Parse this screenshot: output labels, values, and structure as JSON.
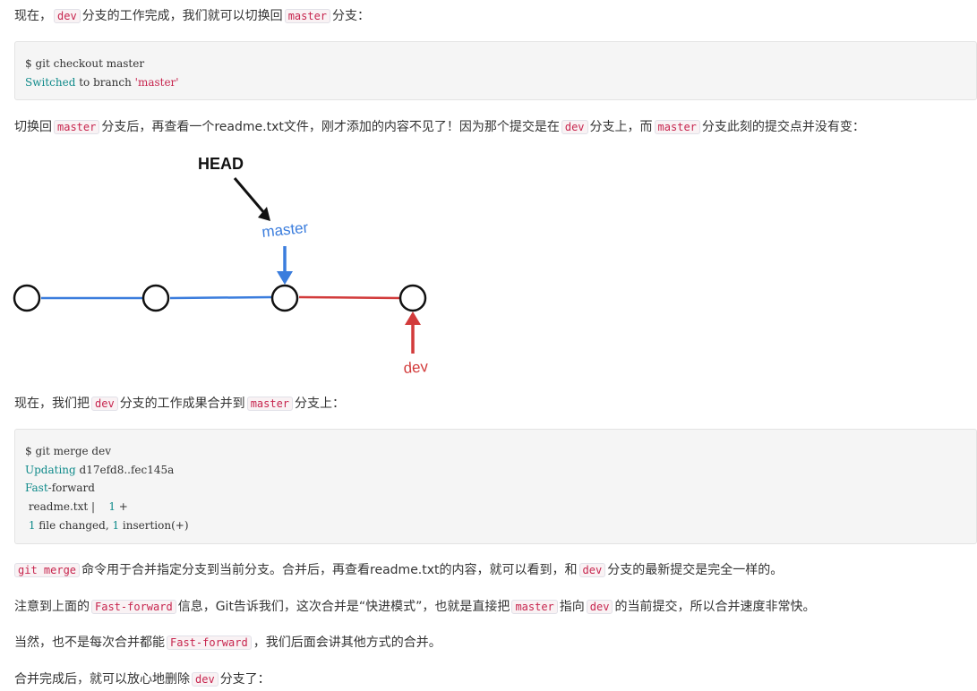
{
  "p1": {
    "a": "现在，",
    "code1": "dev",
    "b": "分支的工作完成，我们就可以切换回",
    "code2": "master",
    "c": "分支："
  },
  "code1": {
    "line1": "$ git checkout master",
    "line2_kw": "Switched",
    "line2_mid": " to branch ",
    "line2_str": "'master'"
  },
  "p2": {
    "a": "切换回",
    "code1": "master",
    "b": "分支后，再查看一个readme.txt文件，刚才添加的内容不见了！因为那个提交是在",
    "code2": "dev",
    "c": "分支上，而",
    "code3": "master",
    "d": "分支此刻的提交点并没有变："
  },
  "diagram": {
    "head_label": "HEAD",
    "master_label": "master",
    "dev_label": "dev",
    "colors": {
      "blue": "#3b7ddd",
      "red": "#d23b3b",
      "black": "#111111"
    }
  },
  "p3": {
    "a": "现在，我们把",
    "code1": "dev",
    "b": "分支的工作成果合并到",
    "code2": "master",
    "c": "分支上："
  },
  "code2": {
    "line1": "$ git merge dev",
    "line2_kw": "Updating",
    "line2_rest": " d17efd8..fec145a",
    "line3_kw": "Fast",
    "line3_rest": "-forward",
    "line4_a": " readme.txt |    ",
    "line4_num": "1",
    "line4_b": " +",
    "line5_num1": " 1",
    "line5_a": " file changed, ",
    "line5_num2": "1",
    "line5_b": " insertion(+)"
  },
  "p4": {
    "code1": "git merge",
    "a": "命令用于合并指定分支到当前分支。合并后，再查看readme.txt的内容，就可以看到，和",
    "code2": "dev",
    "b": "分支的最新提交是完全一样的。"
  },
  "p5": {
    "a": "注意到上面的",
    "code1": "Fast-forward",
    "b": "信息，Git告诉我们，这次合并是“快进模式”，也就是直接把",
    "code2": "master",
    "c": "指向",
    "code3": "dev",
    "d": "的当前提交，所以合并速度非常快。"
  },
  "p6": {
    "a": "当然，也不是每次合并都能",
    "code1": "Fast-forward",
    "b": "，我们后面会讲其他方式的合并。"
  },
  "p7": {
    "a": "合并完成后，就可以放心地删除",
    "code1": "dev",
    "b": "分支了："
  }
}
